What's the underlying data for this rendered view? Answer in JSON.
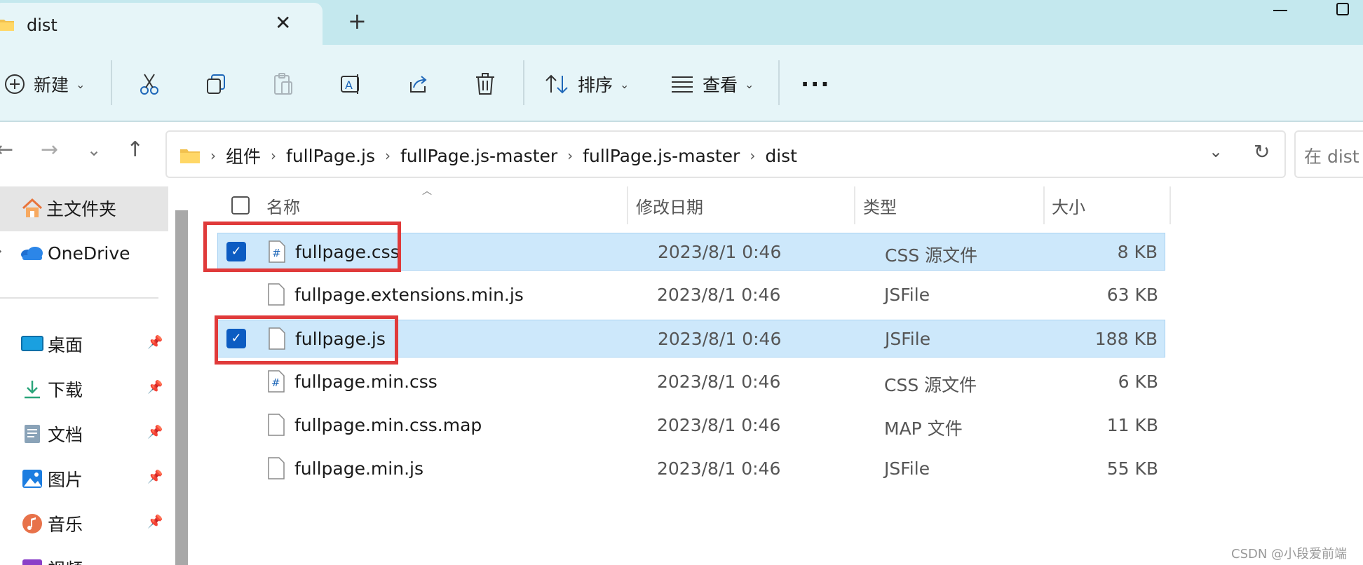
{
  "window": {
    "tab_title": "dist",
    "close_tab_glyph": "✕",
    "new_tab_glyph": "+"
  },
  "toolbar": {
    "new_label": "新建",
    "sort_label": "排序",
    "view_label": "查看",
    "more_glyph": "···",
    "icons": [
      "plus-circle-icon",
      "cut-icon",
      "copy-icon",
      "paste-icon",
      "rename-icon",
      "share-icon",
      "delete-icon",
      "sort-icon",
      "view-icon",
      "more-icon"
    ]
  },
  "address": {
    "crumbs": [
      "组件",
      "fullPage.js",
      "fullPage.js-master",
      "fullPage.js-master",
      "dist"
    ],
    "separator": "›",
    "search_placeholder": "在 dist ..."
  },
  "nav_pane": {
    "home": "主文件夹",
    "onedrive": "OneDrive",
    "items": [
      "桌面",
      "下载",
      "文档",
      "图片",
      "音乐",
      "视频"
    ]
  },
  "columns": {
    "name": "名称",
    "date": "修改日期",
    "type": "类型",
    "size": "大小"
  },
  "files": [
    {
      "name": "fullpage.css",
      "date": "2023/8/1 0:46",
      "type": "CSS 源文件",
      "size": "8 KB",
      "selected": true,
      "icon": "css-file-icon"
    },
    {
      "name": "fullpage.extensions.min.js",
      "date": "2023/8/1 0:46",
      "type": "JSFile",
      "size": "63 KB",
      "selected": false,
      "icon": "file-icon"
    },
    {
      "name": "fullpage.js",
      "date": "2023/8/1 0:46",
      "type": "JSFile",
      "size": "188 KB",
      "selected": true,
      "icon": "file-icon"
    },
    {
      "name": "fullpage.min.css",
      "date": "2023/8/1 0:46",
      "type": "CSS 源文件",
      "size": "6 KB",
      "selected": false,
      "icon": "css-file-icon"
    },
    {
      "name": "fullpage.min.css.map",
      "date": "2023/8/1 0:46",
      "type": "MAP 文件",
      "size": "11 KB",
      "selected": false,
      "icon": "file-icon"
    },
    {
      "name": "fullpage.min.js",
      "date": "2023/8/1 0:46",
      "type": "JSFile",
      "size": "55 KB",
      "selected": false,
      "icon": "file-icon"
    }
  ],
  "colors": {
    "selection": "#cde8fb",
    "checkbox": "#0c5cc2",
    "annotation": "#e03a3a",
    "titlebar": "#c4e8ee"
  },
  "watermark": "CSDN @小段爱前端"
}
